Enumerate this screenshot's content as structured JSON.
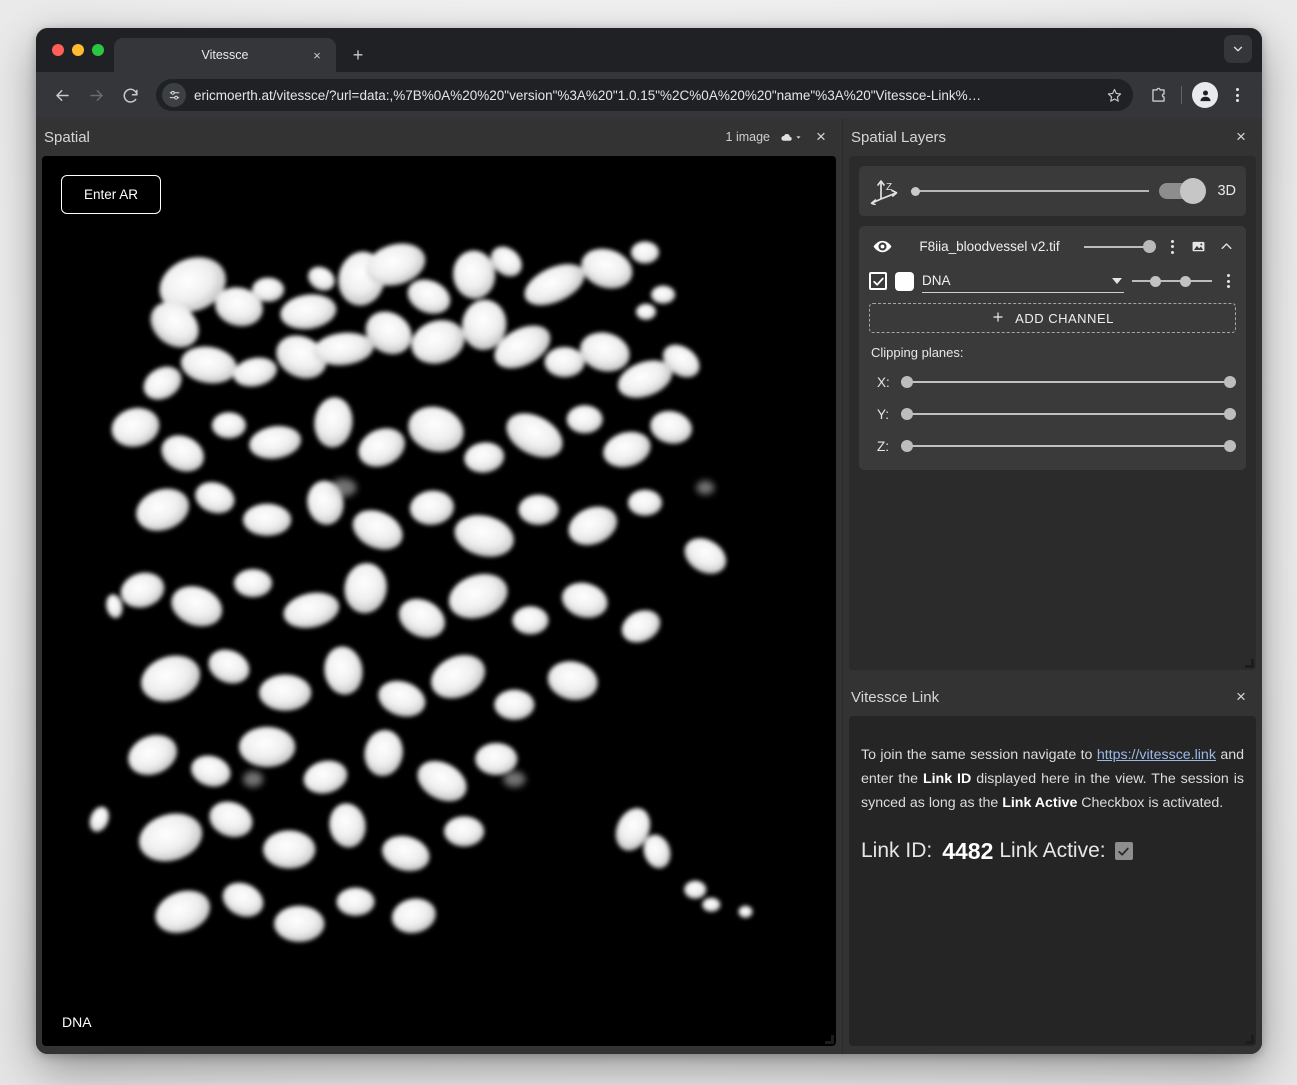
{
  "browser": {
    "tab": {
      "title": "Vitessce",
      "close_label": "×"
    },
    "new_tab_label": "+",
    "url": "ericmoerth.at/vitessce/?url=data:,%7B%0A%20%20\"version\"%3A%20\"1.0.15\"%2C%0A%20%20\"name\"%3A%20\"Vitessce-Link%…",
    "icons": {
      "back": "back-arrow",
      "forward": "forward-arrow",
      "reload": "reload",
      "site_settings": "tune-icon",
      "bookmark": "star-icon",
      "extensions": "puzzle-icon",
      "profile": "person-icon",
      "menu": "three-dot-menu",
      "tab_search": "chevron-down-icon"
    }
  },
  "spatial": {
    "title": "Spatial",
    "image_count": "1 image",
    "download_icon": "cloud-download-icon",
    "close_label": "×",
    "enter_ar_label": "Enter AR",
    "channel_caption": "DNA"
  },
  "layers": {
    "title": "Spatial Layers",
    "close_label": "×",
    "dimension": {
      "axis_icon": "z-axis-icon",
      "axis_label": "Z",
      "mode_label": "3D"
    },
    "layer": {
      "name": "F8iia_bloodvessel v2.tif",
      "visibility_icon": "eye-icon",
      "menu_icon": "three-dot-menu",
      "image_icon": "image-icon",
      "collapse_icon": "chevron-up-icon"
    },
    "channels": [
      {
        "name": "DNA",
        "checked": true,
        "color": "#ffffff",
        "menu_icon": "three-dot-menu"
      }
    ],
    "add_channel_label": "ADD CHANNEL",
    "add_channel_icon": "plus-icon",
    "clipping": {
      "title": "Clipping planes:",
      "planes": [
        {
          "label": "X:"
        },
        {
          "label": "Y:"
        },
        {
          "label": "Z:"
        }
      ]
    }
  },
  "vitessce_link": {
    "title": "Vitessce Link",
    "close_label": "×",
    "description": {
      "part1": "To join the same session navigate to ",
      "link_text": "https://vitessce.link",
      "part2": " and enter the ",
      "bold1": "Link ID",
      "part3": " displayed here in the view. The session is synced as long as the ",
      "bold2": "Link Active",
      "part4": " Checkbox is activated."
    },
    "link_id_label": "Link ID:",
    "link_id_value": "4482",
    "link_active_label": "Link Active:",
    "link_active_checked": true
  },
  "colors": {
    "panel_bg": "#333333",
    "card_bg": "#3a3a3a",
    "canvas_bg": "#000000",
    "accent_link": "#9ab9e8"
  }
}
